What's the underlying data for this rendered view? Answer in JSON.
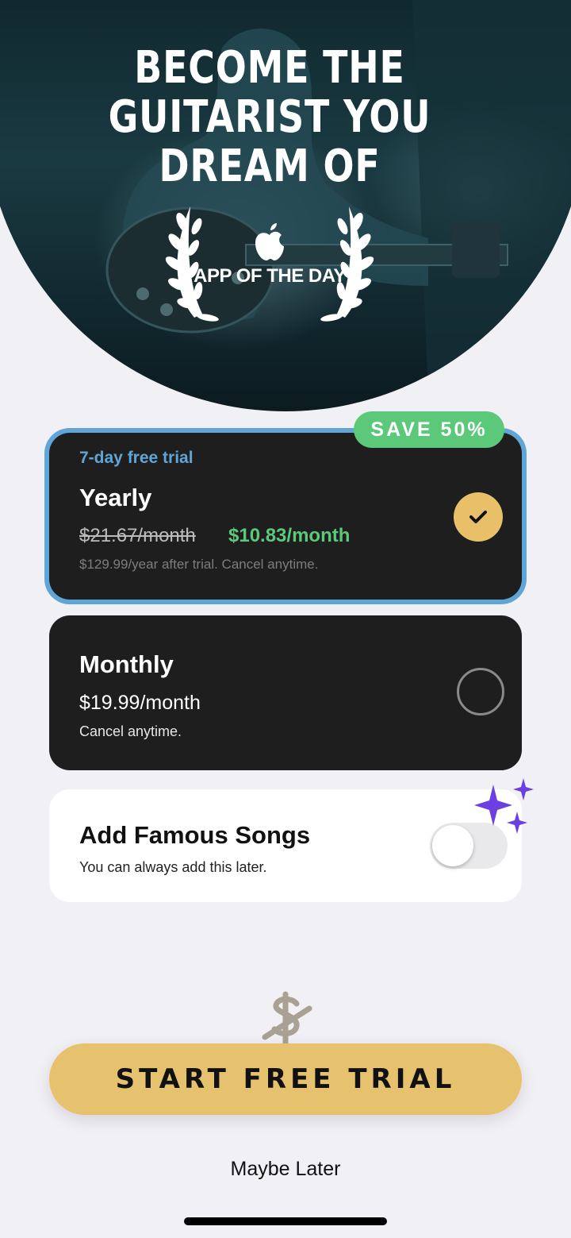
{
  "hero": {
    "headline": "BECOME THE GUITARIST YOU DREAM OF",
    "award_label": "APP OF THE DAY"
  },
  "plans": {
    "yearly": {
      "badge": "SAVE 50%",
      "trial": "7-day free trial",
      "name": "Yearly",
      "old_price": "$21.67/month",
      "new_price": "$10.83/month",
      "fine_print": "$129.99/year after trial. Cancel anytime.",
      "selected": true
    },
    "monthly": {
      "name": "Monthly",
      "price": "$19.99/month",
      "fine_print": "Cancel anytime.",
      "selected": false
    }
  },
  "addon": {
    "title": "Add Famous Songs",
    "subtitle": "You can always add this later.",
    "enabled": false
  },
  "cta": {
    "label": "START FREE TRIAL"
  },
  "secondary": {
    "label": "Maybe Later"
  },
  "colors": {
    "accent_gold": "#e6c26f",
    "selected_border": "#5fa5d6",
    "save_green": "#5cc97a",
    "sparkle_purple": "#6b3fe0"
  }
}
